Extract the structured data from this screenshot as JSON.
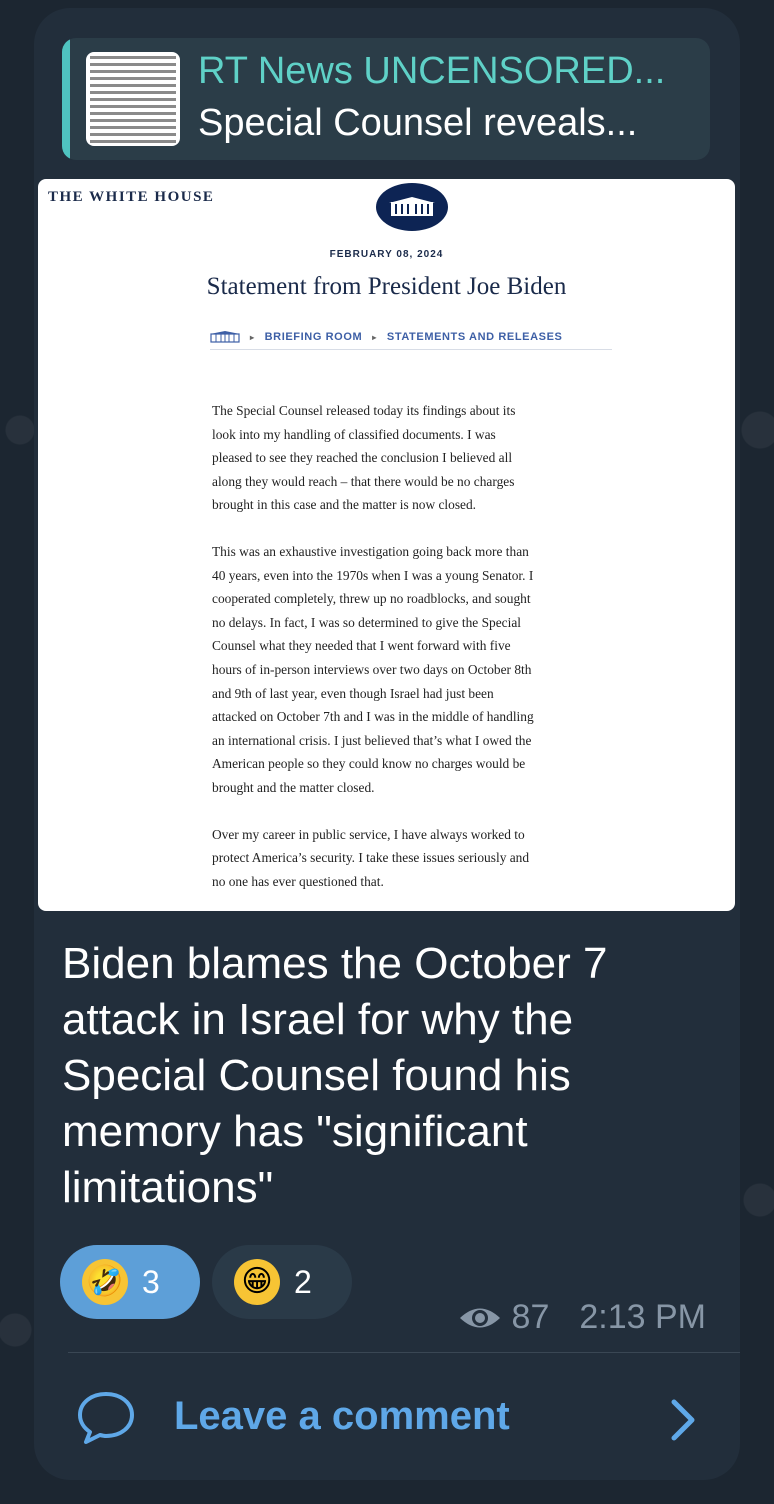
{
  "reply": {
    "channel": "RT News UNCENSORED...",
    "text": "Special Counsel reveals..."
  },
  "document": {
    "header": "THE WHITE HOUSE",
    "date": "FEBRUARY 08, 2024",
    "title": "Statement from President Joe Biden",
    "breadcrumbs": [
      "BRIEFING ROOM",
      "STATEMENTS AND RELEASES"
    ],
    "paragraphs": [
      "The Special Counsel released today its findings about its\nlook into my handling of classified documents. I was\npleased to see they reached the conclusion I believed all\nalong they would reach – that there would be no charges\nbrought in this case and the matter is now closed.",
      "This was an exhaustive investigation going back more than\n40 years, even into the 1970s when I was a young Senator. I\ncooperated completely, threw up no roadblocks, and sought\nno delays. In fact, I was so determined to give the Special\nCounsel what they needed that I went forward with five\nhours of in-person interviews over two days on October 8th\nand 9th of last year, even though Israel had just been\nattacked on October 7th and I was in the middle of handling\nan international crisis. I just believed that’s what I owed the\nAmerican people so they could know no charges would be\nbrought and the matter closed.",
      "Over my career in public service, I have always worked to\nprotect America’s security. I take these issues seriously and\nno one has ever questioned that."
    ]
  },
  "caption": "Biden blames the October 7 attack in Israel for why the Special Counsel found his memory has \"significant limitations\"",
  "reactions": [
    {
      "emoji": "🤣",
      "count": "3",
      "selected": true
    },
    {
      "emoji": "😁",
      "count": "2",
      "selected": false
    }
  ],
  "meta": {
    "views": "87",
    "time": "2:13 PM"
  },
  "comment": {
    "label": "Leave a comment"
  },
  "colors": {
    "accent": "#5fa8e8",
    "reply_bar": "#4fc3c0",
    "bubble": "#222e3b"
  }
}
